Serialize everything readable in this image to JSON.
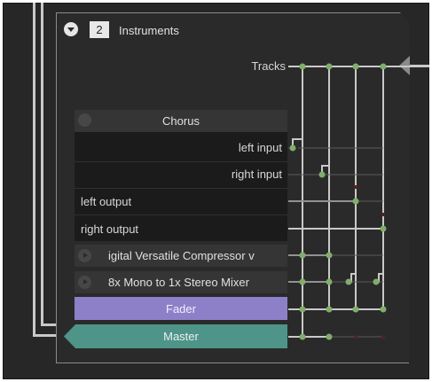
{
  "header": {
    "number": "2",
    "title": "Instruments"
  },
  "tracks_label": "Tracks",
  "chorus": {
    "title": "Chorus",
    "pins": {
      "left_input": "left input",
      "right_input": "right input",
      "left_output": "left output",
      "right_output": "right output"
    }
  },
  "fx": {
    "compressor": "igital Versatile Compressor v",
    "mixer": "8x Mono to 1x Stereo Mixer"
  },
  "fader": {
    "label": "Fader",
    "color": "#8d80c8"
  },
  "master": {
    "label": "Master",
    "color": "#4e9488"
  },
  "colors": {
    "node_on": "#7fae6a",
    "node_off": "#5a1f1f",
    "wire": "#c9c9c9"
  }
}
